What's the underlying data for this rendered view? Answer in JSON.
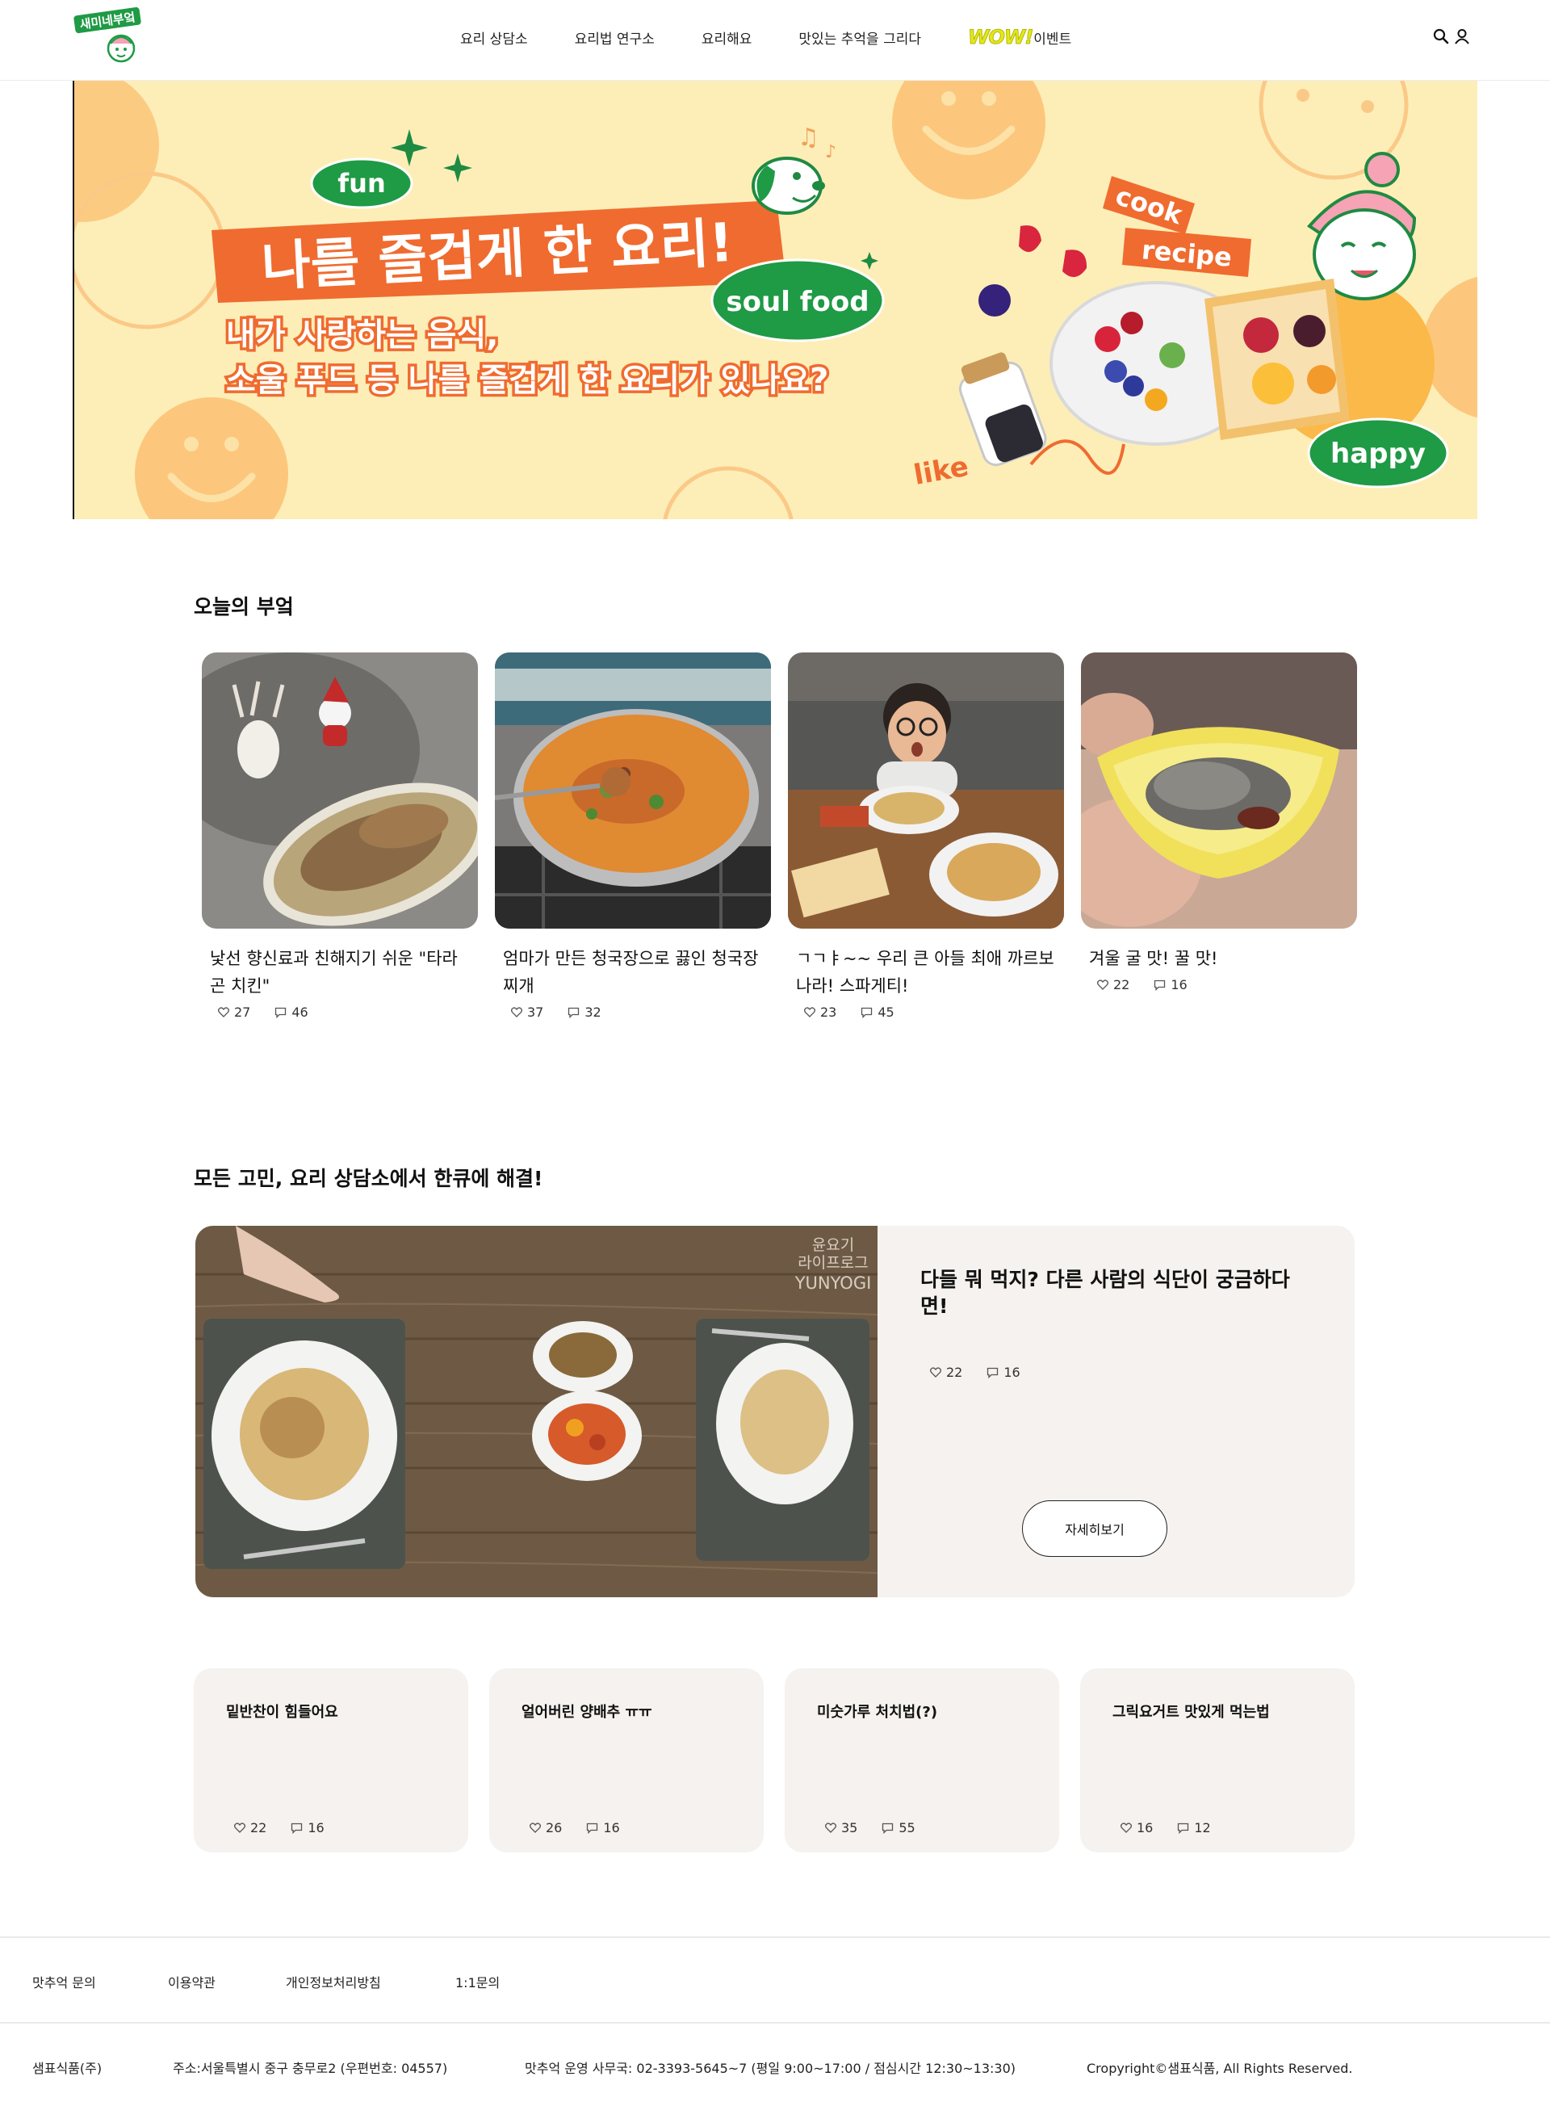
{
  "header": {
    "logo_text": "새미네부엌",
    "nav": [
      "요리 상담소",
      "요리법 연구소",
      "요리해요",
      "맛있는 추억을 그리다"
    ],
    "event_badge": "WOW!",
    "event_label": "이벤트",
    "icons": [
      "search-icon",
      "user-icon"
    ]
  },
  "banner": {
    "tag_fun": "fun",
    "headline": "나를 즐겁게 한 요리!",
    "tag_soul_food": "soul food",
    "sub_line1": "내가 사랑하는 음식,",
    "sub_line2": "소울 푸드 등 나를 즐겁게 한 요리가 있나요?",
    "tag_cook": "cook",
    "tag_recipe": "recipe",
    "tag_happy": "happy",
    "tag_like": "like"
  },
  "today": {
    "title": "오늘의 부엌",
    "cards": [
      {
        "title": "낯선 향신료과 친해지기 쉬운 \"타라곤 치킨\"",
        "likes": "27",
        "comments": "46"
      },
      {
        "title": "엄마가 만든 청국장으로 끓인 청국장찌개",
        "likes": "37",
        "comments": "32"
      },
      {
        "title": "ㄱㄱㅑ~~ 우리 큰 아들 최애 까르보나라! 스파게티!",
        "likes": "23",
        "comments": "45"
      },
      {
        "title": "겨울 굴 맛! 꿀 맛!",
        "likes": "22",
        "comments": "16"
      }
    ]
  },
  "consult": {
    "title": "모든 고민, 요리 상담소에서 한큐에 해결!",
    "feature": {
      "watermark": [
        "윤요기",
        "라이프로그",
        "YUNYOGI"
      ],
      "title": "다들 뭐 먹지? 다른 사람의 식단이 궁금하다면!",
      "likes": "22",
      "comments": "16",
      "button": "자세히보기"
    },
    "questions": [
      {
        "title": "밑반찬이 힘들어요",
        "likes": "22",
        "comments": "16"
      },
      {
        "title": "얼어버린 양배추 ㅠㅠ",
        "likes": "26",
        "comments": "16"
      },
      {
        "title": "미숫가루 처치법(?)",
        "likes": "35",
        "comments": "55"
      },
      {
        "title": "그릭요거트 맛있게 먹는법",
        "likes": "16",
        "comments": "12"
      }
    ]
  },
  "footer": {
    "links": [
      "맛추억 문의",
      "이용약관",
      "개인정보처리방침",
      "1:1문의"
    ],
    "company": "샘표식품(주)",
    "address": "주소:서울특별시 중구 충무로2 (우편번호: 04557)",
    "office": "맛추억 운영 사무국: 02-3393-5645~7 (평일 9:00~17:00 / 점심시간 12:30~13:30)",
    "copyright": "Cropyright©샘표식품, All Rights Reserved."
  },
  "colors": {
    "brand_green": "#1f9a45",
    "banner_orange": "#f06b2f",
    "banner_bg": "#fdeeb8",
    "card_bg": "#f5f2ef"
  }
}
